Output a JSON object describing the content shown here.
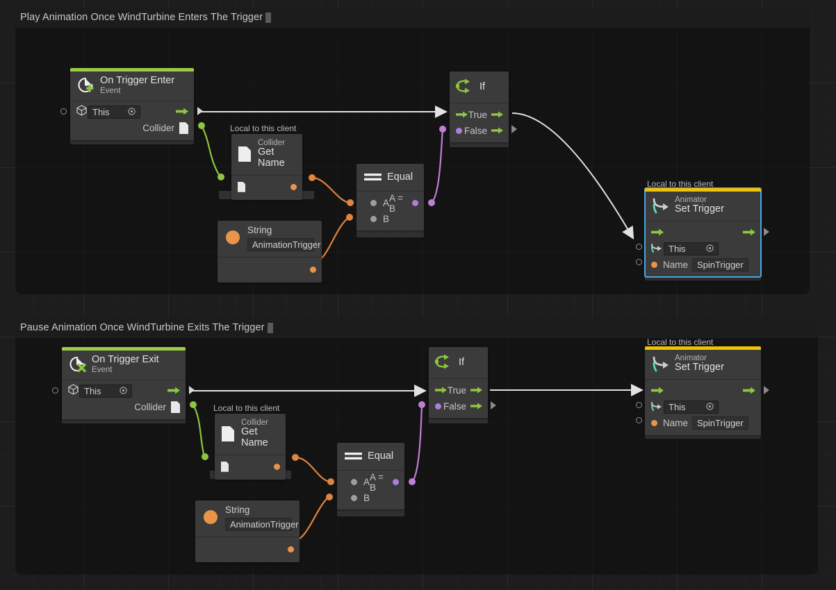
{
  "app": {
    "canvas_background": "#1d1d1d",
    "grid_color": "#2a2a2a",
    "accent_green": "#9acd45",
    "accent_yellow": "#f2c200",
    "accent_orange": "#e8954a",
    "accent_purple": "#b07ddb",
    "selection_blue": "#4ca6e0",
    "wire_exec_color": "#e8e8e8",
    "wire_data_orange": "#e0843f",
    "wire_data_green": "#8dc63f",
    "wire_data_purple": "#c07fd6"
  },
  "groups": [
    {
      "title": "Play Animation Once WindTurbine Enters The Trigger"
    },
    {
      "title": "Pause Animation Once WindTurbine Exits The Trigger"
    }
  ],
  "local_tags": {
    "get_name_top": "Local to this client",
    "animator_top": "Local to this client",
    "get_name_bottom": "Local to this client",
    "animator_bottom": "Local to this client"
  },
  "nodes": {
    "trigger_enter": {
      "icon": "trigger-enter-icon",
      "subtitle": "Event",
      "title": "On Trigger Enter",
      "object_field": "This",
      "output_label": "Collider"
    },
    "get_name_top": {
      "icon": "collider-document-icon",
      "subtitle": "Collider",
      "title": "Get Name"
    },
    "equal_top": {
      "icon": "equal-icon",
      "title": "Equal",
      "input_a": "A",
      "input_b": "B",
      "output": "A = B"
    },
    "string_top": {
      "icon": "string-orange-icon",
      "title": "String",
      "value": "AnimationTrigger"
    },
    "if_top": {
      "icon": "branch-icon",
      "title": "If",
      "true_label": "True",
      "false_label": "False"
    },
    "animator_top": {
      "icon": "animator-icon",
      "subtitle": "Animator",
      "title": "Set Trigger",
      "object_field": "This",
      "name_label": "Name",
      "name_value": "SpinTrigger",
      "selected": true
    },
    "trigger_exit": {
      "icon": "trigger-exit-icon",
      "subtitle": "Event",
      "title": "On Trigger Exit",
      "object_field": "This",
      "output_label": "Collider"
    },
    "get_name_bottom": {
      "icon": "collider-document-icon",
      "subtitle": "Collider",
      "title": "Get Name"
    },
    "equal_bottom": {
      "icon": "equal-icon",
      "title": "Equal",
      "input_a": "A",
      "input_b": "B",
      "output": "A = B"
    },
    "string_bottom": {
      "icon": "string-orange-icon",
      "title": "String",
      "value": "AnimationTrigger"
    },
    "if_bottom": {
      "icon": "branch-icon",
      "title": "If",
      "true_label": "True",
      "false_label": "False"
    },
    "animator_bottom": {
      "icon": "animator-icon",
      "subtitle": "Animator",
      "title": "Set Trigger",
      "object_field": "This",
      "name_label": "Name",
      "name_value": "SpinTrigger",
      "selected": false
    }
  }
}
